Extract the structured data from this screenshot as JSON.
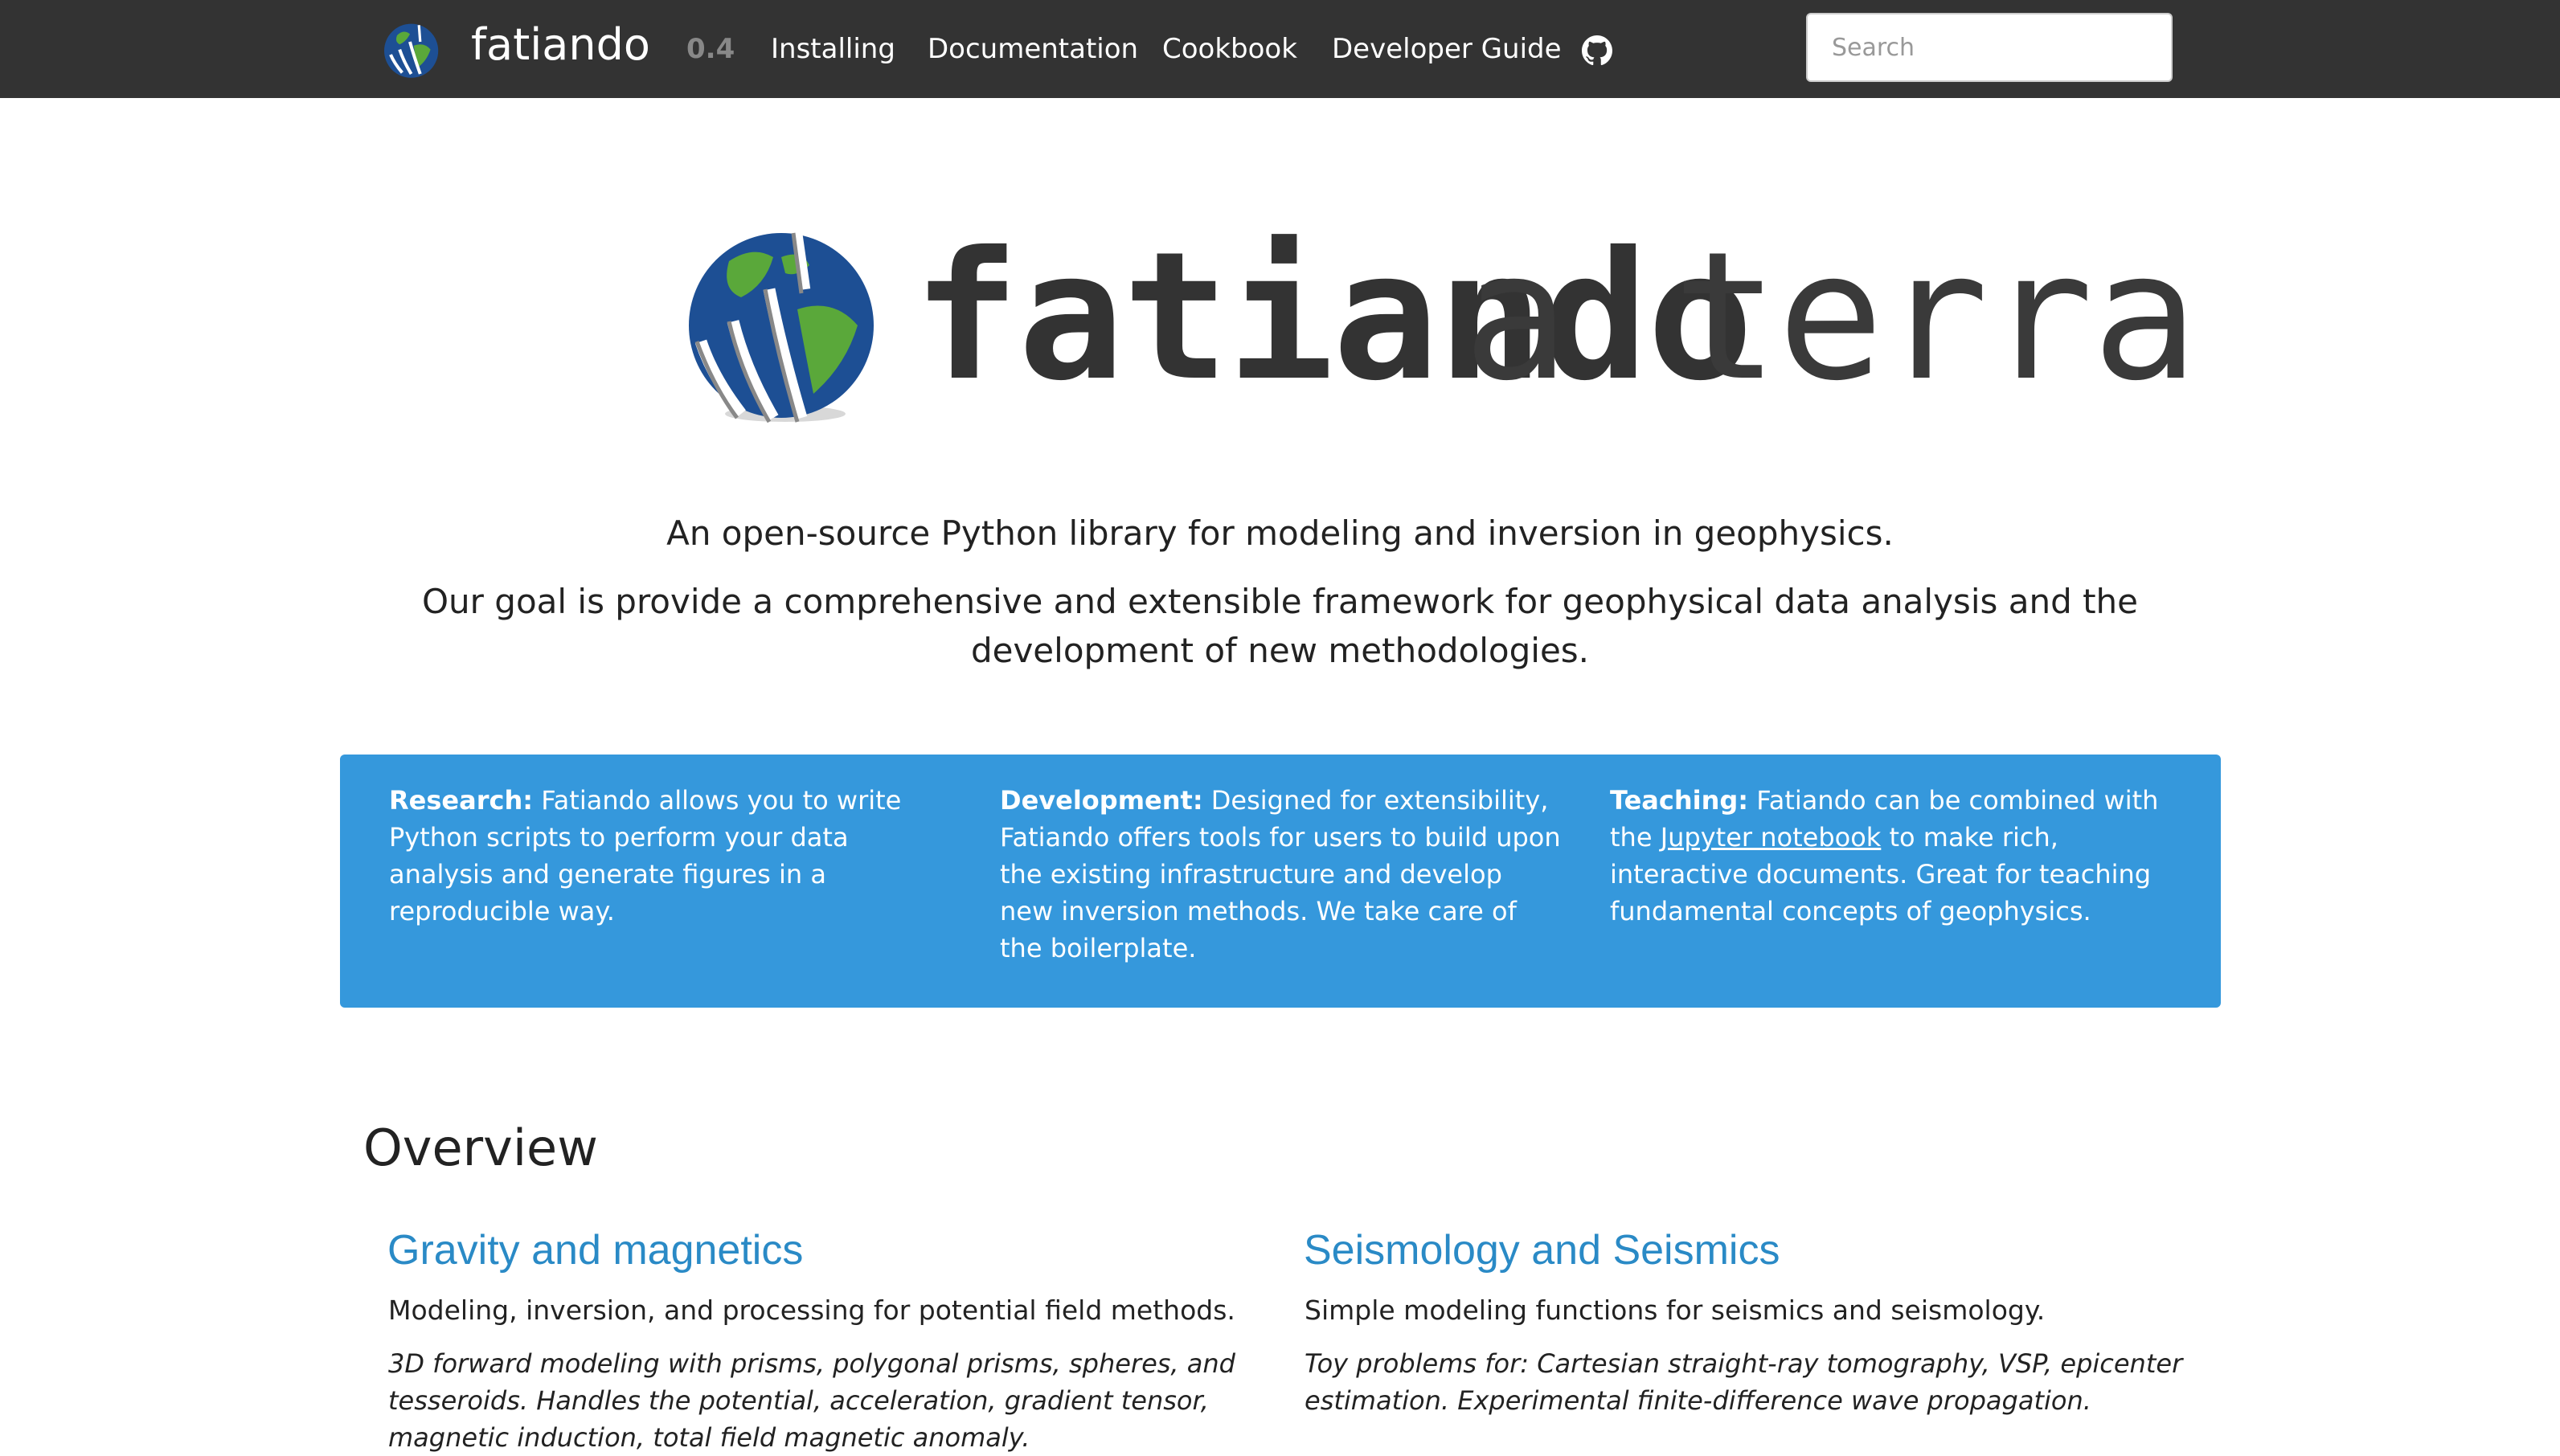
{
  "navbar": {
    "brand": "fatiando",
    "version": "0.4",
    "links": [
      "Installing",
      "Documentation",
      "Cookbook",
      "Developer Guide"
    ],
    "github_icon": "github-icon",
    "search_placeholder": "Search"
  },
  "hero": {
    "logo_words": [
      "fatiando",
      "a terra"
    ],
    "tagline": "An open-source Python library for modeling and inversion in geophysics.",
    "goal": "Our goal is provide a comprehensive and extensible framework for geophysical data analysis and the development of new methodologies."
  },
  "features": [
    {
      "label": "Research:",
      "text": " Fatiando allows you to write Python scripts to perform your data analysis and generate figures in a reproducible way."
    },
    {
      "label": "Development:",
      "text": " Designed for extensibility, Fatiando offers tools for users to build upon the existing infrastructure and develop new inversion methods. We take care of the boilerplate."
    },
    {
      "label": "Teaching:",
      "text_before": " Fatiando can be combined with the ",
      "link": "Jupyter notebook",
      "text_after": " to make rich, interactive documents. Great for teaching fundamental concepts of geophysics."
    }
  ],
  "overview": {
    "title": "Overview",
    "sections": [
      {
        "title": "Gravity and magnetics",
        "description": "Modeling, inversion, and processing for potential field methods.",
        "detail": "3D forward modeling with prisms, polygonal prisms, spheres, and tesseroids. Handles the potential, acceleration, gradient tensor, magnetic induction, total field magnetic anomaly."
      },
      {
        "title": "Seismology and Seismics",
        "description": "Simple modeling functions for seismics and seismology.",
        "detail": "Toy problems for: Cartesian straight-ray tomography, VSP, epicenter estimation. Experimental finite-difference wave propagation."
      }
    ]
  },
  "colors": {
    "navbar_bg": "#333333",
    "feature_bg": "#3598dc",
    "link": "#2a8ac6",
    "globe_ocean": "#1d4f94",
    "globe_land": "#5aa83a"
  }
}
